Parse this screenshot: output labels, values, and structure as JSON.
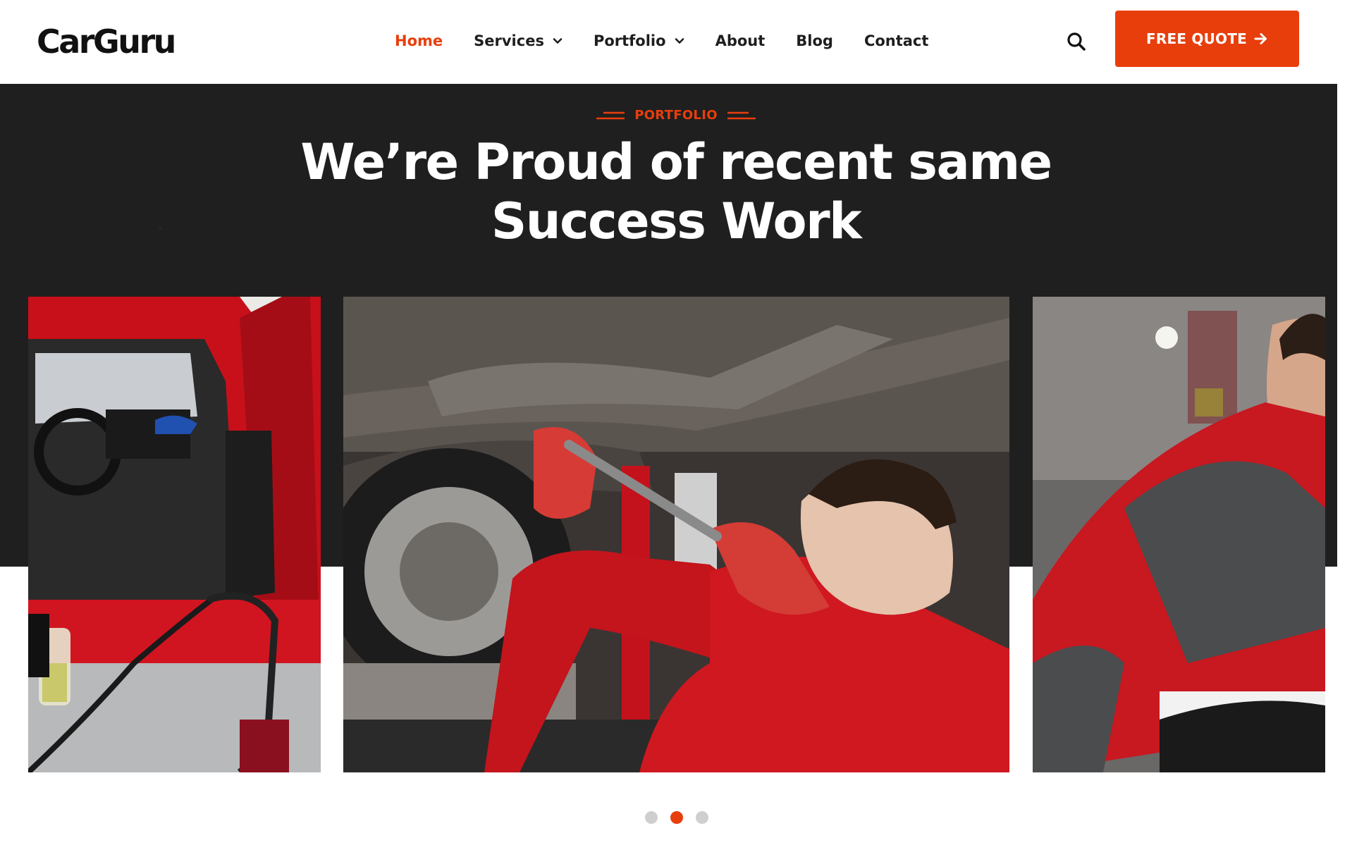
{
  "header": {
    "logo": "CarGuru",
    "nav": [
      {
        "label": "Home",
        "active": true,
        "dropdown": false
      },
      {
        "label": "Services",
        "active": false,
        "dropdown": true
      },
      {
        "label": "Portfolio",
        "active": false,
        "dropdown": true
      },
      {
        "label": "About",
        "active": false,
        "dropdown": false
      },
      {
        "label": "Blog",
        "active": false,
        "dropdown": false
      },
      {
        "label": "Contact",
        "active": false,
        "dropdown": false
      }
    ],
    "search_icon": "search-icon",
    "cta_label": "FREE QUOTE",
    "cta_icon": "arrow-right-icon"
  },
  "section": {
    "eyebrow": "PORTFOLIO",
    "title_line1": "We’re Proud of recent same",
    "title_line2": "Success Work"
  },
  "gallery": {
    "items": [
      {
        "name": "car-interior-cleaning-image"
      },
      {
        "name": "mechanic-under-car-image"
      },
      {
        "name": "mechanic-engine-image"
      }
    ]
  },
  "pagination": {
    "count": 3,
    "active_index": 1
  },
  "colors": {
    "accent": "#e83e0c",
    "dark_bg": "#1f1f1f",
    "text": "#1e1e1e",
    "dot_inactive": "#cfcfcf"
  }
}
